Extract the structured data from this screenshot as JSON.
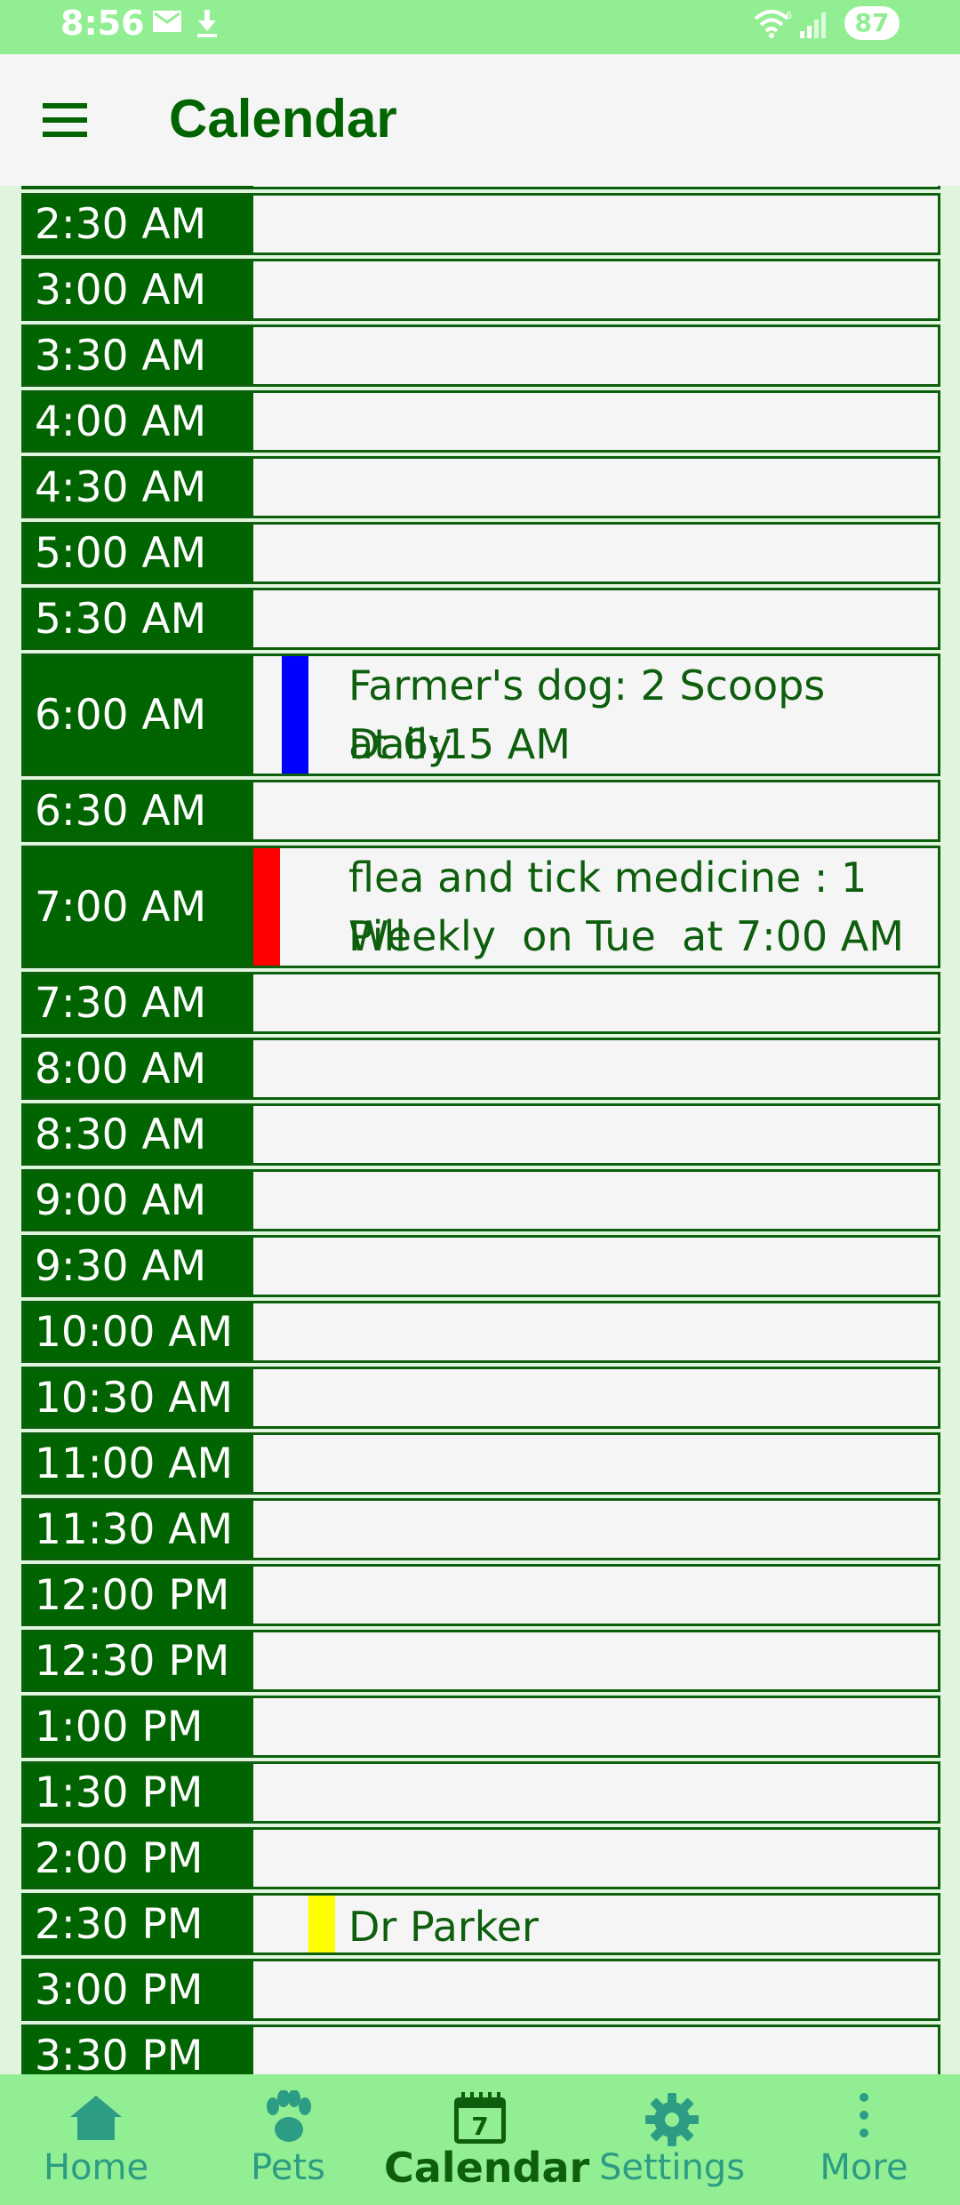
{
  "status_bar": {
    "time": "8:56",
    "battery": "87"
  },
  "app_bar": {
    "title": "Calendar"
  },
  "schedule": {
    "slots": [
      {
        "time": "2:30 AM"
      },
      {
        "time": "3:00 AM"
      },
      {
        "time": "3:30 AM"
      },
      {
        "time": "4:00 AM"
      },
      {
        "time": "4:30 AM"
      },
      {
        "time": "5:00 AM"
      },
      {
        "time": "5:30 AM"
      },
      {
        "time": "6:00 AM",
        "event_line1": "Farmer's dog: 2 Scoops Daily",
        "event_line2": "at 6:15 AM",
        "event_color": "#0000ff"
      },
      {
        "time": "6:30 AM"
      },
      {
        "time": "7:00 AM",
        "event_line1": "flea and tick medicine : 1 Pill",
        "event_line2": "Weekly  on Tue  at 7:00 AM",
        "event_color": "#ff0000"
      },
      {
        "time": "7:30 AM"
      },
      {
        "time": "8:00 AM"
      },
      {
        "time": "8:30 AM"
      },
      {
        "time": "9:00 AM"
      },
      {
        "time": "9:30 AM"
      },
      {
        "time": "10:00 AM"
      },
      {
        "time": "10:30 AM"
      },
      {
        "time": "11:00 AM"
      },
      {
        "time": "11:30 AM"
      },
      {
        "time": "12:00 PM"
      },
      {
        "time": "12:30 PM"
      },
      {
        "time": "1:00 PM"
      },
      {
        "time": "1:30 PM"
      },
      {
        "time": "2:00 PM"
      },
      {
        "time": "2:30 PM",
        "event_line1": "Dr Parker",
        "event_color": "#ffff00"
      },
      {
        "time": "3:00 PM"
      },
      {
        "time": "3:30 PM"
      }
    ]
  },
  "bottom_nav": {
    "items": [
      {
        "label": "Home",
        "icon": "home-icon"
      },
      {
        "label": "Pets",
        "icon": "paw-icon"
      },
      {
        "label": "Calendar",
        "icon": "calendar-icon",
        "icon_text": "7",
        "active": true
      },
      {
        "label": "Settings",
        "icon": "gear-icon"
      },
      {
        "label": "More",
        "icon": "more-vert-icon"
      }
    ]
  },
  "colors": {
    "accent": "#006400",
    "status_bar": "#92ee92",
    "nav_icon": "#2c9c84",
    "row_bg": "#f5f5f5"
  }
}
